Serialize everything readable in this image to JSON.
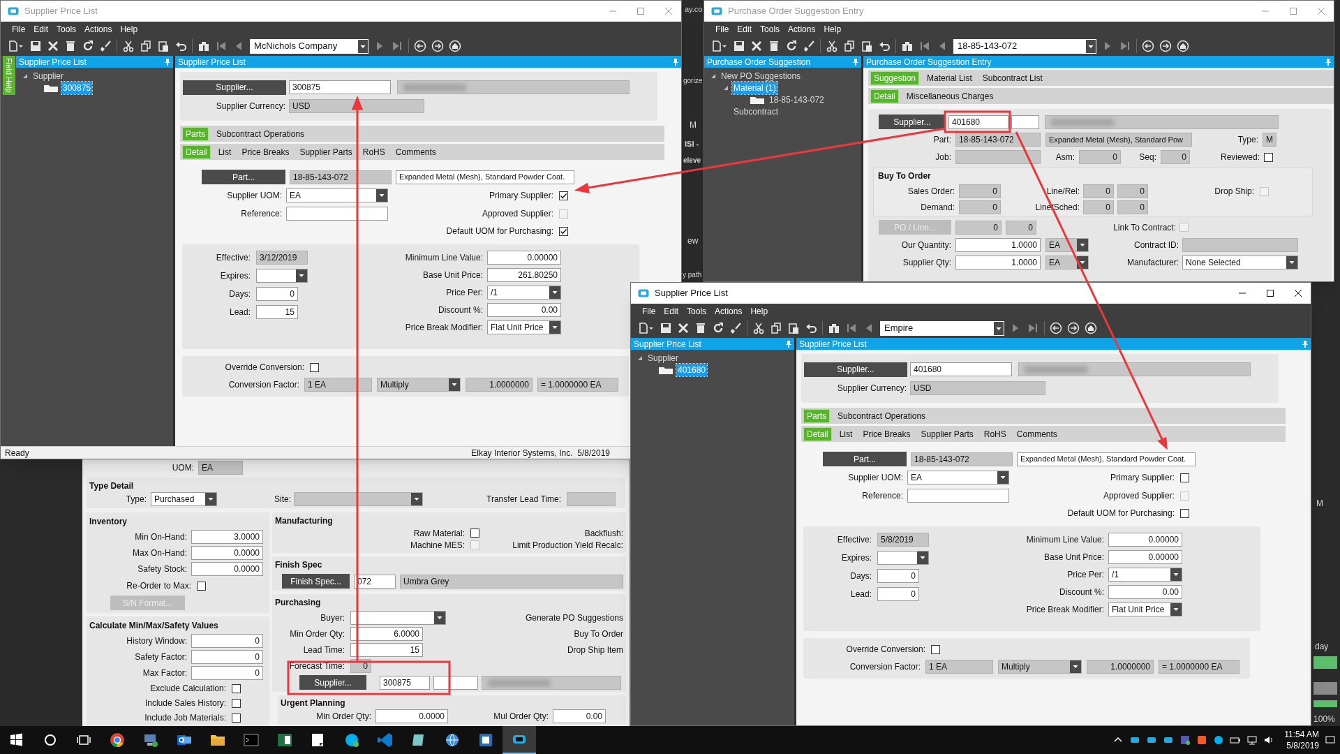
{
  "desktop_texts": [
    {
      "text": "ay.co"
    },
    {
      "text": "gorize"
    },
    {
      "text": "M"
    },
    {
      "text": "ISI -"
    },
    {
      "text": "eleve"
    },
    {
      "text": "ew"
    },
    {
      "text": "y path"
    },
    {
      "text": "M"
    },
    {
      "text": "day"
    },
    {
      "text": "100%"
    }
  ],
  "back_window": {
    "uom_label": "UOM:",
    "uom": "EA",
    "type_detail": {
      "title": "Type Detail",
      "type_label": "Type:",
      "type": "Purchased",
      "site_label": "Site:",
      "transfer_label": "Transfer Lead Time:"
    },
    "inventory": {
      "title": "Inventory",
      "fields": [
        {
          "label": "Min On-Hand:",
          "value": "3.0000"
        },
        {
          "label": "Max On-Hand:",
          "value": "0.0000"
        },
        {
          "label": "Safety Stock:",
          "value": "0.0000"
        }
      ],
      "reorder_label": "Re-Order to Max:",
      "reorder": {
        "checked": false
      },
      "sn_button": "S/N Format...",
      "sn_disabled": true
    },
    "calculate": {
      "title": "Calculate Min/Max/Safety Values",
      "fields": [
        {
          "label": "History Window:",
          "value": "0"
        },
        {
          "label": "Safety Factor:",
          "value": "0"
        },
        {
          "label": "Max Factor:",
          "value": "0"
        }
      ],
      "options": [
        {
          "label": "Exclude Calculation:",
          "checked": false
        },
        {
          "label": "Include Sales History:",
          "checked": false
        },
        {
          "label": "Include Job Materials:",
          "checked": false
        }
      ]
    },
    "manufacturing": {
      "title": "Manufacturing",
      "options": [
        {
          "label": "Raw Material:",
          "checked": false,
          "disabled": false
        },
        {
          "label": "Machine MES:",
          "checked": false,
          "disabled": true
        }
      ],
      "right_labels": [
        "Backflush:",
        "Limit Production Yield Recalc:"
      ]
    },
    "finish_spec": {
      "title": "Finish Spec",
      "button": "Finish Spec...",
      "code": "072",
      "description": "Umbra Grey"
    },
    "purchasing": {
      "title": "Purchasing",
      "buyer_label": "Buyer:",
      "fields": [
        {
          "label": "Min Order Qty:",
          "value": "6.0000",
          "kind": "number"
        },
        {
          "label": "Lead Time:",
          "value": "15",
          "kind": "number"
        },
        {
          "label": "Forecast Time:",
          "value": "0",
          "kind": "readonly_number"
        }
      ],
      "right_labels": [
        "Generate PO Suggestions",
        "Buy To Order",
        "Drop Ship Item"
      ],
      "supplier_button": "Supplier...",
      "supplier_id": "300875"
    },
    "urgent": {
      "title": "Urgent Planning",
      "min_label": "Min Order Qty:",
      "min": "0.0000",
      "mul_label": "Mul Order Qty:",
      "mul": "0.00"
    }
  },
  "left_window": {
    "title": "Supplier Price List",
    "active": false,
    "menu": [
      "File",
      "Edit",
      "Tools",
      "Actions",
      "Help"
    ],
    "toolbar_value": "McNichols Company",
    "field_help": "Field Help",
    "tree_title": "Supplier Price List",
    "tree": [
      {
        "label": "Supplier",
        "kind": "group",
        "expanded": true,
        "selected": false,
        "children": [
          {
            "label": "300875",
            "kind": "record",
            "selected": true
          }
        ]
      }
    ],
    "panel_title": "Supplier Price List",
    "supplier_button": "Supplier...",
    "supplier_id": "300875",
    "currency_label": "Supplier Currency:",
    "currency": "USD",
    "tabs": [
      {
        "label": "Parts",
        "selected": true
      },
      {
        "label": "Subcontract Operations",
        "selected": false
      }
    ],
    "subtabs": [
      {
        "label": "Detail",
        "selected": true
      },
      {
        "label": "List",
        "selected": false
      },
      {
        "label": "Price Breaks",
        "selected": false
      },
      {
        "label": "Supplier Parts",
        "selected": false
      },
      {
        "label": "RoHS",
        "selected": false
      },
      {
        "label": "Comments",
        "selected": false
      }
    ],
    "part_button": "Part...",
    "part_number": "18-85-143-072",
    "part_description": "Expanded Metal (Mesh), Standard Powder Coat.",
    "uom_label": "Supplier UOM:",
    "uom": "EA",
    "reference_label": "Reference:",
    "flags": [
      {
        "label": "Primary Supplier:",
        "checked": true,
        "disabled": false
      },
      {
        "label": "Approved Supplier:",
        "checked": false,
        "disabled": true
      },
      {
        "label": "Default UOM for Purchasing:",
        "checked": true,
        "disabled": false
      }
    ],
    "terms": [
      {
        "label": "Effective:",
        "value": "3/12/2019",
        "kind": "readonly"
      },
      {
        "label": "Expires:",
        "kind": "dropdown"
      },
      {
        "label": "Days:",
        "value": "0",
        "kind": "number"
      },
      {
        "label": "Lead:",
        "value": "15",
        "kind": "number"
      }
    ],
    "pricing": [
      {
        "label": "Minimum Line Value:",
        "value": "0.00000",
        "kind": "number"
      },
      {
        "label": "Base Unit Price:",
        "value": "261.80250",
        "kind": "number"
      },
      {
        "label": "Price Per:",
        "value": "/1",
        "kind": "dropdown"
      },
      {
        "label": "Discount %:",
        "value": "0.00",
        "kind": "number"
      },
      {
        "label": "Price Break Modifier:",
        "value": "Flat Unit Price",
        "kind": "dropdown"
      }
    ],
    "override_label": "Override Conversion:",
    "override_checked": false,
    "conversion_label": "Conversion Factor:",
    "conversion": [
      {
        "value": "1 EA",
        "kind": "readonly"
      },
      {
        "value": "Multiply",
        "kind": "readonly_dropdown"
      },
      {
        "value": "1.0000000",
        "kind": "readonly_number"
      },
      {
        "value": "= 1.0000000 EA",
        "kind": "readonly"
      }
    ],
    "status_left": "Ready",
    "status_right": "Elkay Interior Systems, Inc.  5/8/2019"
  },
  "top_right_window": {
    "title": "Purchase Order Suggestion Entry",
    "active": false,
    "menu": [
      "File",
      "Edit",
      "Tools",
      "Actions",
      "Help"
    ],
    "toolbar_value": "18-85-143-072",
    "tree_title": "Purchase Order Suggestion",
    "tree": [
      {
        "label": "New PO Suggestions",
        "kind": "group",
        "expanded": true,
        "selected": false,
        "children": [
          {
            "label": "Material (1)",
            "kind": "group",
            "expanded": true,
            "selected": true,
            "children": [
              {
                "label": "18-85-143-072",
                "kind": "record",
                "selected": false
              }
            ]
          },
          {
            "label": "Subcontract",
            "kind": "group",
            "selected": false
          }
        ]
      }
    ],
    "panel_title": "Purchase Order Suggestion Entry",
    "tabs": [
      {
        "label": "Suggestion",
        "selected": true
      },
      {
        "label": "Material List",
        "selected": false
      },
      {
        "label": "Subcontract List",
        "selected": false
      }
    ],
    "subtabs": [
      {
        "label": "Detail",
        "selected": true
      },
      {
        "label": "Miscellaneous Charges",
        "selected": false
      }
    ],
    "supplier_button": "Supplier...",
    "supplier_id": "401680",
    "part_label": "Part:",
    "part_number": "18-85-143-072",
    "part_description": "Expanded Metal (Mesh), Standard Pow",
    "type_label": "Type:",
    "type": "M",
    "job_label": "Job:",
    "asm_label": "Asm:",
    "asm": "0",
    "seq_label": "Seq:",
    "seq": "0",
    "reviewed_label": "Reviewed:",
    "reviewed": {
      "checked": false,
      "disabled": false
    },
    "buy_to_order": {
      "title": "Buy To Order",
      "rows": [
        {
          "label": "Sales Order:",
          "value": "0",
          "pair_label": "Line/Rel:",
          "pair": [
            "0",
            "0"
          ]
        },
        {
          "label": "Demand:",
          "value": "0",
          "pair_label": "Line/Sched:",
          "pair": [
            "0",
            "0"
          ]
        }
      ],
      "drop_ship_label": "Drop Ship:",
      "drop_ship": {
        "checked": false,
        "disabled": true
      }
    },
    "po_line_button": "PO / Line...",
    "po_line_disabled": true,
    "po_line": [
      "0",
      "0"
    ],
    "link_contract_label": "Link To Contract:",
    "link_contract": {
      "checked": false,
      "disabled": true
    },
    "our_qty_label": "Our Quantity:",
    "our_qty": "1.0000",
    "our_uom": "EA",
    "contract_label": "Contract ID:",
    "supplier_qty_label": "Supplier Qty:",
    "supplier_qty": "1.0000",
    "supplier_uom": "EA",
    "manufacturer_label": "Manufacturer:",
    "manufacturer": "None Selected"
  },
  "front_window": {
    "title": "Supplier Price List",
    "active": true,
    "menu": [
      "File",
      "Edit",
      "Tools",
      "Actions",
      "Help"
    ],
    "toolbar_value": "Empire",
    "tree_title": "Supplier Price List",
    "tree": [
      {
        "label": "Supplier",
        "kind": "group",
        "expanded": true,
        "selected": false,
        "children": [
          {
            "label": "401680",
            "kind": "record",
            "selected": true
          }
        ]
      }
    ],
    "panel_title": "Supplier Price List",
    "supplier_button": "Supplier...",
    "supplier_id": "401680",
    "currency_label": "Supplier Currency:",
    "currency": "USD",
    "tabs": [
      {
        "label": "Parts",
        "selected": true
      },
      {
        "label": "Subcontract Operations",
        "selected": false
      }
    ],
    "subtabs": [
      {
        "label": "Detail",
        "selected": true
      },
      {
        "label": "List",
        "selected": false
      },
      {
        "label": "Price Breaks",
        "selected": false
      },
      {
        "label": "Supplier Parts",
        "selected": false
      },
      {
        "label": "RoHS",
        "selected": false
      },
      {
        "label": "Comments",
        "selected": false
      }
    ],
    "part_button": "Part...",
    "part_number": "18-85-143-072",
    "part_description": "Expanded Metal (Mesh), Standard Powder Coat.",
    "uom_label": "Supplier UOM:",
    "uom": "EA",
    "reference_label": "Reference:",
    "flags": [
      {
        "label": "Primary Supplier:",
        "checked": false,
        "disabled": false
      },
      {
        "label": "Approved Supplier:",
        "checked": false,
        "disabled": true
      },
      {
        "label": "Default UOM for Purchasing:",
        "checked": false,
        "disabled": false
      }
    ],
    "terms": [
      {
        "label": "Effective:",
        "value": "5/8/2019",
        "kind": "readonly"
      },
      {
        "label": "Expires:",
        "kind": "dropdown"
      },
      {
        "label": "Days:",
        "value": "0",
        "kind": "number"
      },
      {
        "label": "Lead:",
        "value": "0",
        "kind": "number"
      }
    ],
    "pricing": [
      {
        "label": "Minimum Line Value:",
        "value": "0.00000",
        "kind": "number"
      },
      {
        "label": "Base Unit Price:",
        "value": "0.00000",
        "kind": "number"
      },
      {
        "label": "Price Per:",
        "value": "/1",
        "kind": "dropdown"
      },
      {
        "label": "Discount %:",
        "value": "0.00",
        "kind": "number"
      },
      {
        "label": "Price Break Modifier:",
        "value": "Flat Unit Price",
        "kind": "dropdown"
      }
    ],
    "override_label": "Override Conversion:",
    "override_checked": false,
    "conversion_label": "Conversion Factor:",
    "conversion": [
      {
        "value": "1 EA",
        "kind": "readonly"
      },
      {
        "value": "Multiply",
        "kind": "readonly_dropdown"
      },
      {
        "value": "1.0000000",
        "kind": "readonly_number"
      },
      {
        "value": "= 1.0000000 EA",
        "kind": "readonly"
      }
    ]
  },
  "taskbar": {
    "time": "11:54 AM",
    "date": "5/8/2019"
  }
}
